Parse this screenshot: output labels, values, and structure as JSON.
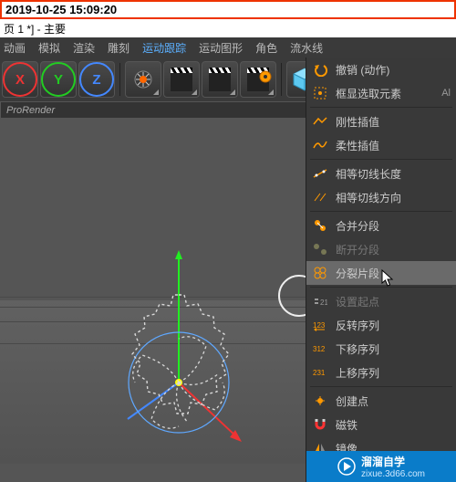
{
  "timestamp": "2019-10-25 15:09:20",
  "window_title": "页 1 *] - 主要",
  "menubar": {
    "items": [
      "动画",
      "模拟",
      "渲染",
      "雕刻",
      "运动跟踪",
      "运动图形",
      "角色",
      "流水线"
    ],
    "highlight_index": 4
  },
  "toolbar": {
    "axes": [
      "X",
      "Y",
      "Z"
    ]
  },
  "viewport": {
    "engine_label": "ProRender"
  },
  "context_menu": {
    "undo": {
      "label": "撤销 (动作)",
      "kbd": ""
    },
    "frame_sel": {
      "label": "框显选取元素",
      "kbd": "Al"
    },
    "rigid": {
      "label": "刚性插值"
    },
    "soft": {
      "label": "柔性插值"
    },
    "eq_len": {
      "label": "相等切线长度"
    },
    "eq_dir": {
      "label": "相等切线方向"
    },
    "merge_seg": {
      "label": "合并分段"
    },
    "break_seg": {
      "label": "断开分段"
    },
    "split_seg": {
      "label": "分裂片段"
    },
    "set_start": {
      "label": "设置起点"
    },
    "reverse": {
      "label": "反转序列"
    },
    "seq_down": {
      "label": "下移序列"
    },
    "seq_up": {
      "label": "上移序列"
    },
    "create_pt": {
      "label": "创建点"
    },
    "magnet": {
      "label": "磁铁"
    },
    "mirror": {
      "label": "镜像"
    }
  },
  "watermark": {
    "brand": "溜溜自学",
    "url": "zixue.3d66.com"
  }
}
